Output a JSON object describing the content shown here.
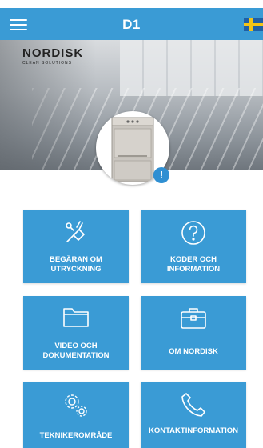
{
  "app": {
    "title": "D1",
    "menu_icon": "hamburger-menu-icon",
    "language_flag": "swedish-flag-icon",
    "brand_color": "#3a9bd5"
  },
  "hero": {
    "logo_main": "NORDISK",
    "logo_sub": "CLEAN SOLUTIONS",
    "info_badge": "!"
  },
  "tiles": [
    {
      "label": "BEGÄRAN OM UTRYCKNING",
      "icon": "service-tools-icon"
    },
    {
      "label": "KODER OCH INFORMATION",
      "icon": "question-circle-icon"
    },
    {
      "label": "VIDEO OCH DOKUMENTATION",
      "icon": "folder-icon"
    },
    {
      "label": "OM NORDISK",
      "icon": "briefcase-icon"
    },
    {
      "label": "TEKNIKEROMRÅDE",
      "icon": "gears-icon"
    },
    {
      "label": "KONTAKTINFORMATION",
      "icon": "phone-icon"
    }
  ]
}
